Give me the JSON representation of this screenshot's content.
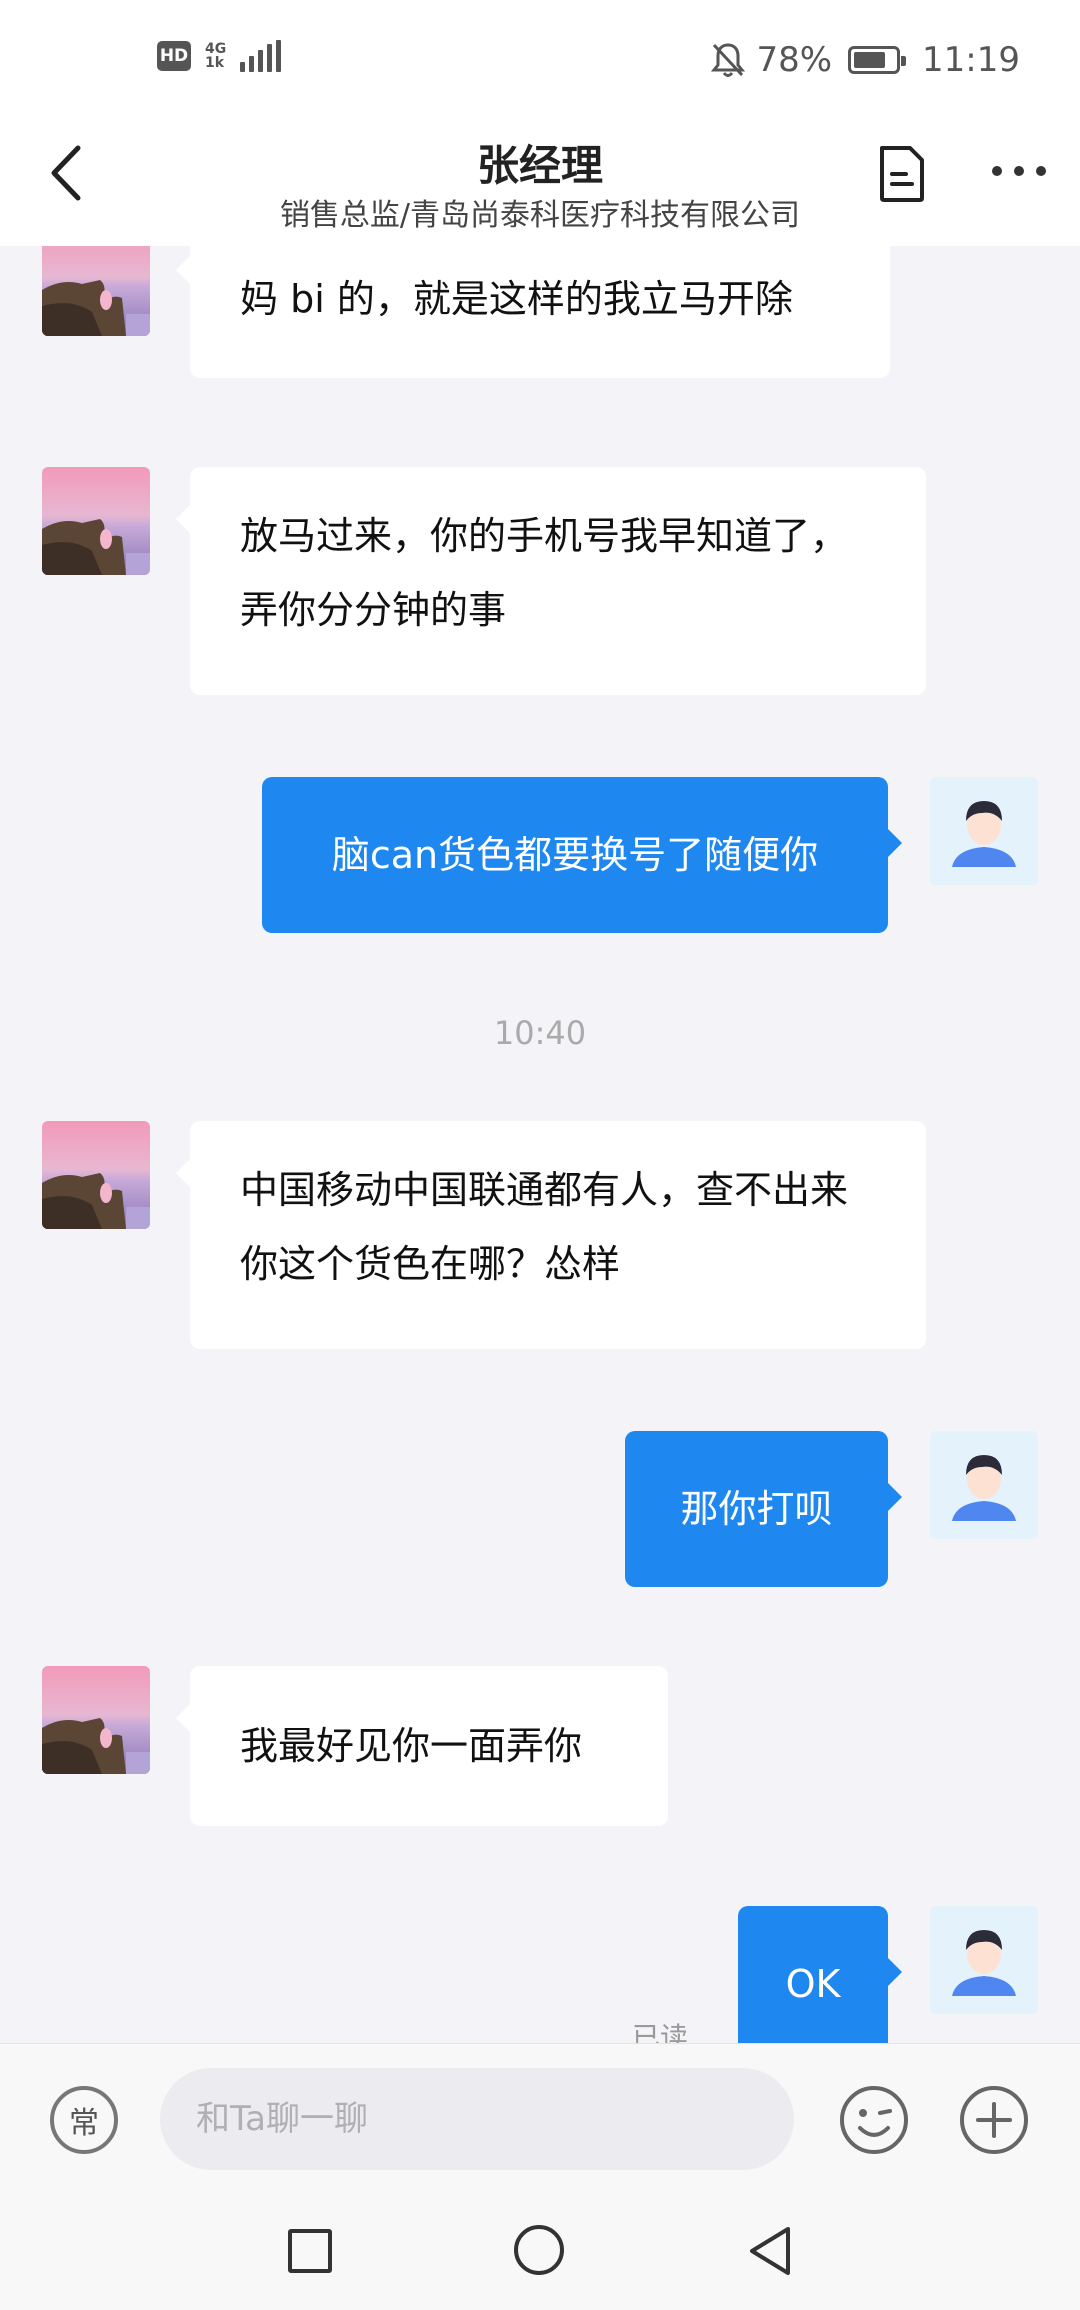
{
  "status_bar": {
    "hd": "HD",
    "network_top": "4G",
    "network_bottom": "1k",
    "battery_percent": "78%",
    "battery_level": 0.78,
    "time": "11:19"
  },
  "header": {
    "title": "张经理",
    "subtitle": "销售总监/青岛尚泰科医疗科技有限公司"
  },
  "colors": {
    "outgoing_bubble": "#1e88f0",
    "incoming_bubble": "#ffffff",
    "background": "#f4f4f8"
  },
  "messages": [
    {
      "side": "left",
      "text": "妈 bi 的，就是这样的我立马开除"
    },
    {
      "side": "left",
      "text": "放马过来，你的手机号我早知道了，弄你分分钟的事"
    },
    {
      "side": "right",
      "text": "脑can货色都要换号了随便你"
    },
    {
      "side": "left",
      "text": "中国移动中国联通都有人，查不出来你这个货色在哪？怂样"
    },
    {
      "side": "right",
      "text": "那你打呗"
    },
    {
      "side": "left",
      "text": "我最好见你一面弄你"
    },
    {
      "side": "right",
      "text": "OK"
    }
  ],
  "timestamp": "10:40",
  "read_label": "已读",
  "input_bar": {
    "common_label": "常",
    "placeholder": "和Ta聊一聊",
    "icons": [
      "emoji-icon",
      "plus-icon"
    ]
  },
  "nav_bar": {
    "icons": [
      "recent-apps-icon",
      "home-icon",
      "back-icon"
    ]
  }
}
